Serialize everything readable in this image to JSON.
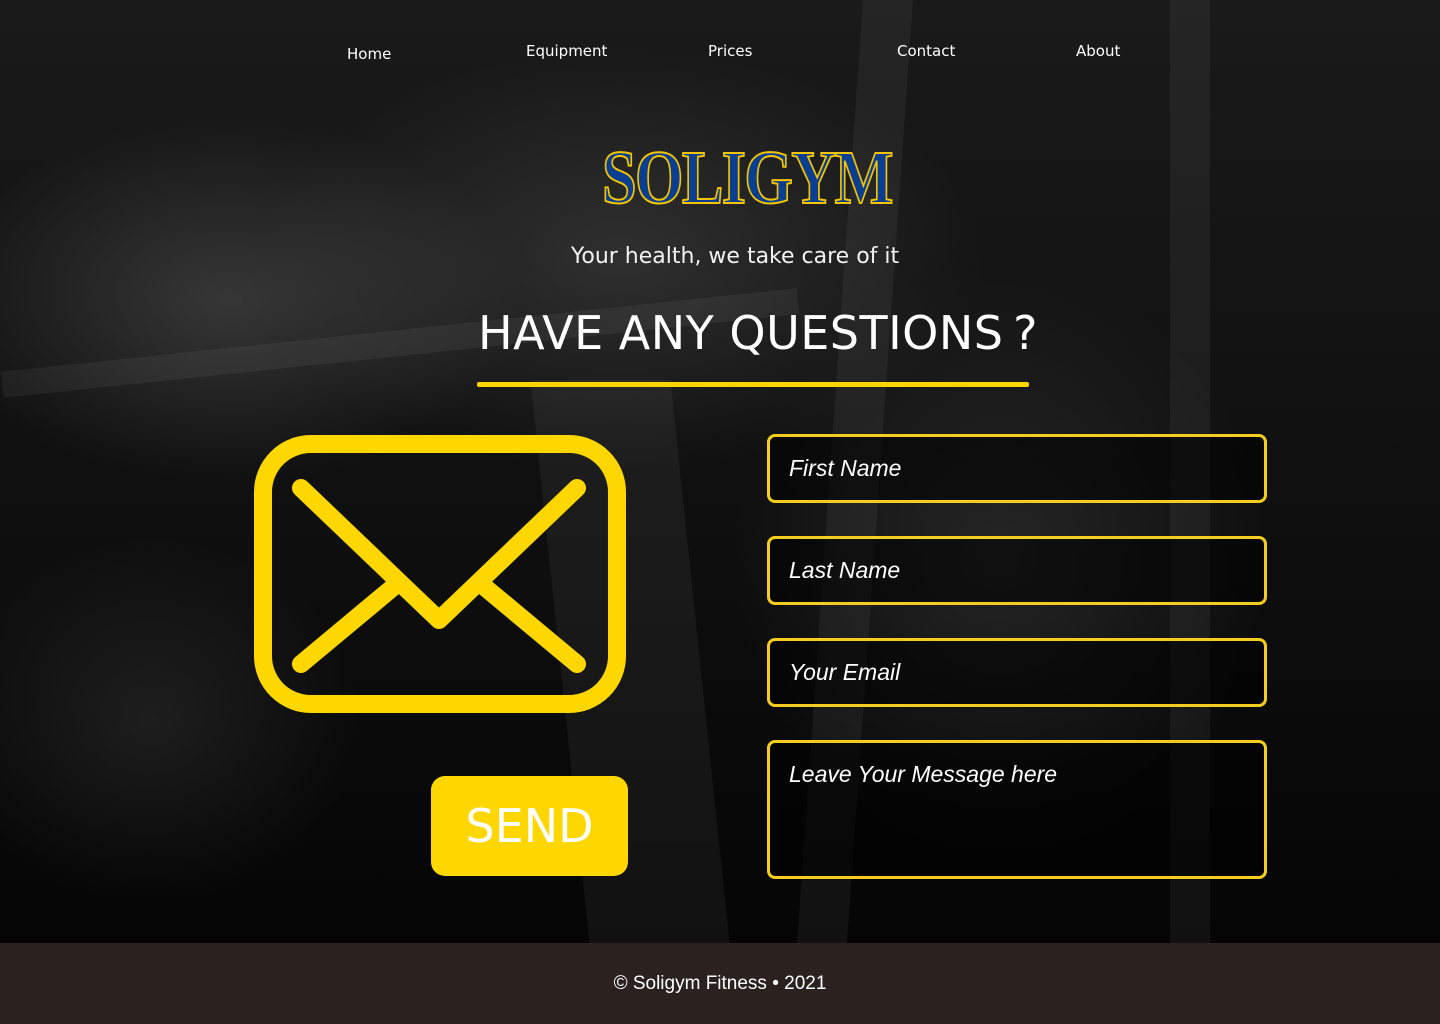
{
  "nav": {
    "items": [
      {
        "label": "Home"
      },
      {
        "label": "Equipment"
      },
      {
        "label": "Prices"
      },
      {
        "label": "Contact"
      },
      {
        "label": "About"
      }
    ]
  },
  "hero": {
    "logo_text": "SOLIGYM",
    "tagline": "Your health, we take care of it",
    "heading": "HAVE ANY QUESTIONS ?"
  },
  "form": {
    "first_name_placeholder": "First Name",
    "last_name_placeholder": "Last Name",
    "email_placeholder": "Your Email",
    "message_placeholder": "Leave Your Message here",
    "send_label": "SEND"
  },
  "footer": {
    "copyright": "© Soligym Fitness • 2021"
  },
  "colors": {
    "accent": "#ffd700",
    "logo_fill": "#0b3d91",
    "logo_stroke": "#f2c500",
    "footer_bg": "#2b2220"
  },
  "icons": [
    "mail-icon"
  ]
}
